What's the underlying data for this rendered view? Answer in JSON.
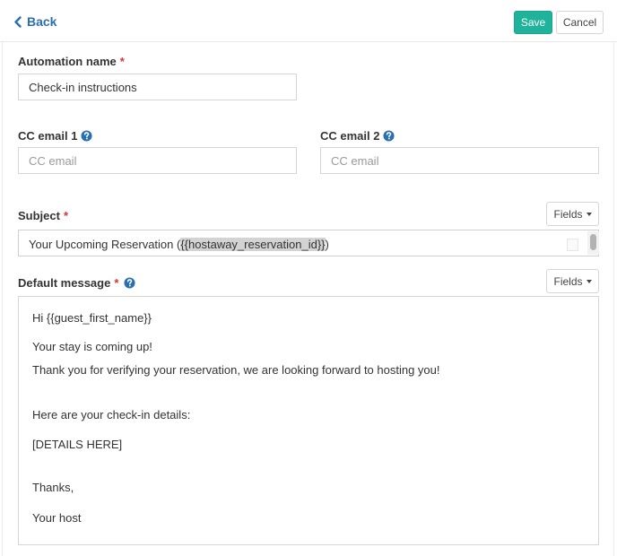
{
  "header": {
    "back_label": "Back",
    "save_label": "Save",
    "cancel_label": "Cancel"
  },
  "form": {
    "automation_name": {
      "label": "Automation name",
      "required_mark": "*",
      "value": "Check-in instructions"
    },
    "cc_email_1": {
      "label": "CC email 1",
      "placeholder": "CC email"
    },
    "cc_email_2": {
      "label": "CC email 2",
      "placeholder": "CC email"
    },
    "subject": {
      "label": "Subject",
      "required_mark": "*",
      "fields_button": "Fields",
      "value_prefix": "Your Upcoming Reservation (",
      "value_token": "{{hostaway_reservation_id}}",
      "value_suffix": ")"
    },
    "default_message": {
      "label": "Default message",
      "required_mark": "*",
      "fields_button": "Fields",
      "lines": [
        "Hi {{guest_first_name}}",
        "Your stay is coming up!",
        "Thank you for verifying your reservation, we are looking forward to hosting you!",
        "Here are your check-in details:",
        "[DETAILS HERE]",
        "Thanks,",
        "Your host"
      ]
    }
  },
  "colors": {
    "primary_button": "#1fb39b",
    "link": "#2a6fb0",
    "required": "#d9362b",
    "help_icon": "#2a6fb0"
  },
  "icons": {
    "back": "chevron-left-icon",
    "help": "question-circle-icon",
    "dropdown": "caret-down-icon"
  }
}
